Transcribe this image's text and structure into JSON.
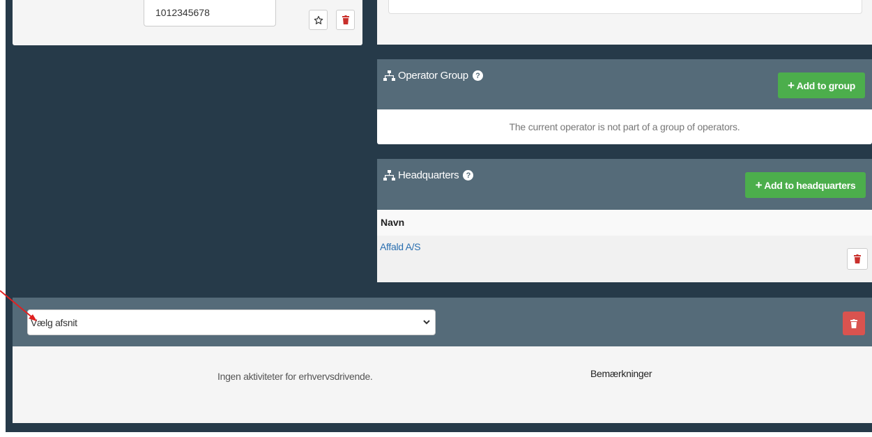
{
  "operator": {
    "phone_value": "1012345678"
  },
  "operator_group": {
    "title": "Operator Group",
    "add_label": "Add to group",
    "empty_text": "The current operator is not part of a group of operators."
  },
  "headquarters": {
    "title": "Headquarters",
    "add_label": "Add to headquarters",
    "column_header": "Navn",
    "rows": [
      {
        "name": "Affald A/S"
      }
    ]
  },
  "section": {
    "select_value": "Vælg afsnit",
    "no_activities": "Ingen aktiviteter for erhvervsdrivende.",
    "remarks_label": "Bemærkninger"
  },
  "colors": {
    "dark_background": "#263a49",
    "panel_header": "#556b79",
    "green_button": "#4cae4c",
    "danger_red": "#d9534f",
    "link_blue": "#2a6fb0",
    "annotation_arrow": "#e02020"
  },
  "icons": {
    "star": "star-icon",
    "trash": "trash-icon",
    "sitemap": "sitemap-icon",
    "help": "help-icon",
    "plus": "plus-icon",
    "chevron": "chevron-down-icon",
    "arrow": "annotation-arrow"
  }
}
